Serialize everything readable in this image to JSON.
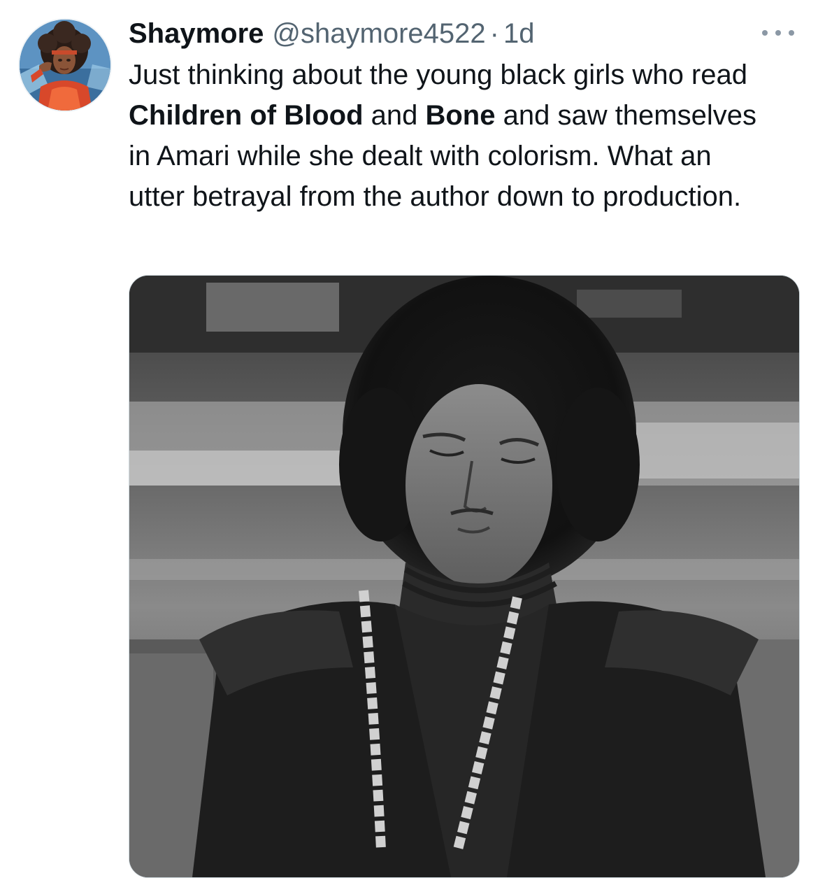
{
  "tweet": {
    "author": {
      "display_name": "Shaymore",
      "handle": "@shaymore4522",
      "separator": "·",
      "time": "1d"
    },
    "text": {
      "part1": "Just thinking about the young black girls who read ",
      "bold1": "Children of Blood",
      "part2": " and ",
      "bold2": "Bone",
      "part3": " and saw themselves in Amari while she dealt with colorism. What an utter betrayal from the author down to production."
    },
    "icons": {
      "more": "more-options-icon"
    }
  }
}
